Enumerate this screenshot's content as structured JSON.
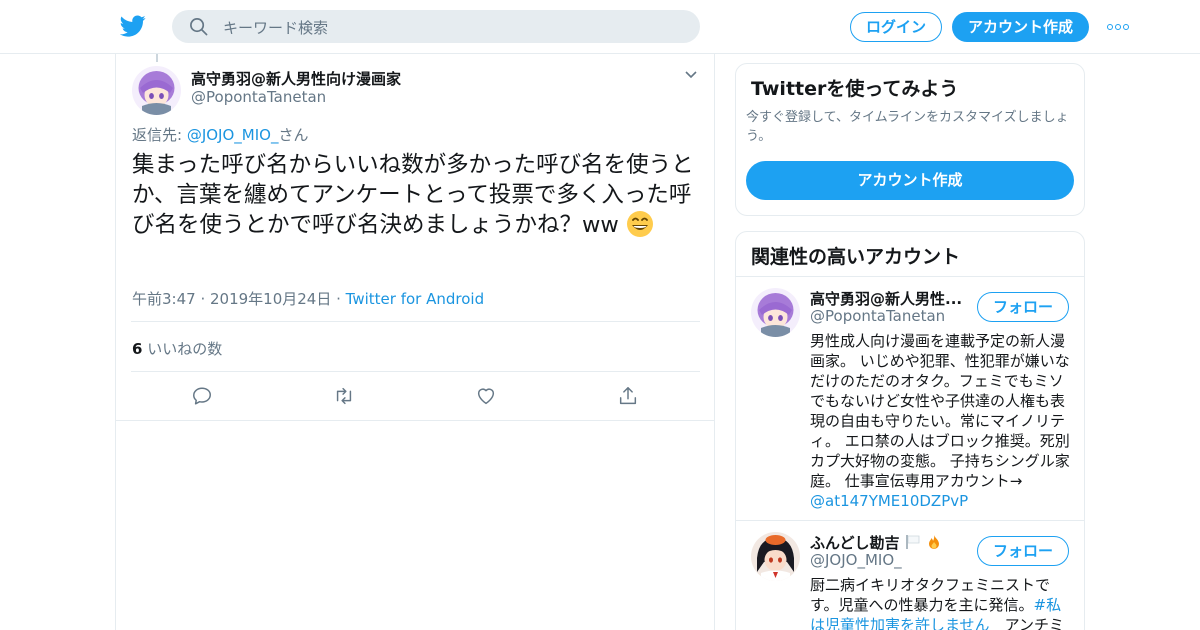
{
  "header": {
    "search_placeholder": "キーワード検索",
    "login_label": "ログイン",
    "signup_label": "アカウント作成"
  },
  "tweet": {
    "author_name": "高守勇羽@新人男性向け漫画家",
    "author_handle": "@PopontaTanetan",
    "reply_prefix": "返信先: ",
    "reply_to": "@JOJO_MIO_",
    "reply_suffix": "さん",
    "text": "集まった呼び名からいいね数が多かった呼び名を使うとか、言葉を纏めてアンケートとって投票で多く入った呼び名を使うとかで呼び名決めましょうかね？ww",
    "timestamp": "午前3:47 · 2019年10月24日",
    "meta_sep": " · ",
    "source": "Twitter for Android",
    "like_count": "6",
    "like_label": "いいねの数"
  },
  "sidebar": {
    "signup_card": {
      "title": "Twitterを使ってみよう",
      "description": "今すぐ登録して、タイムラインをカスタマイズしましょう。",
      "button_label": "アカウント作成"
    },
    "related": {
      "title": "関連性の高いアカウント",
      "accounts": [
        {
          "name": "高守勇羽@新人男性...",
          "handle": "@PopontaTanetan",
          "follow_label": "フォロー",
          "bio": "男性成人向け漫画を連載予定の新人漫画家。 いじめや犯罪、性犯罪が嫌いなだけのただのオタク。フェミでもミソでもないけど女性や子供達の人権も表現の自由も守りたい。常にマイノリティ。 エロ禁の人はブロック推奨。死別カプ大好物の変態。 子持ちシングル家庭。 仕事宣伝専用アカウント→",
          "bio_link": "@at147YME10DZPvP"
        },
        {
          "name": "ふんどし勘吉",
          "handle": "@JOJO_MIO_",
          "follow_label": "フォロー",
          "bio_start": "厨二病イキリオタクフェミニストです。児童への性暴力を主に発信。",
          "bio_link": "#私は児童性加害を許しません",
          "bio_end": "　アンチミ"
        }
      ]
    }
  }
}
